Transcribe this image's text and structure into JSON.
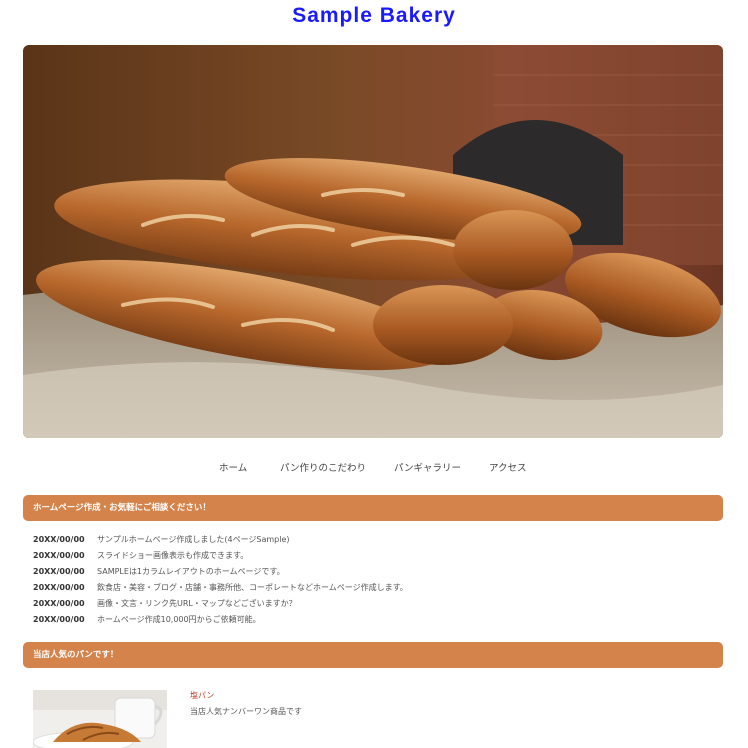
{
  "site": {
    "title": "Sample Bakery",
    "accent_color": "#d4834a",
    "title_color": "#1a1aff"
  },
  "hero": {
    "image": "baguettes-photo"
  },
  "nav": {
    "items": [
      {
        "label": "ホーム"
      },
      {
        "label": "パン作りのこだわり"
      },
      {
        "label": "パンギャラリー"
      },
      {
        "label": "アクセス"
      }
    ]
  },
  "news": {
    "heading": "ホームページ作成・お気軽にご相談ください！",
    "items": [
      {
        "date": "20XX/00/00",
        "text": "サンプルホームページ作成しました(4ページSample)"
      },
      {
        "date": "20XX/00/00",
        "text": "スライドショー画像表示も作成できます。"
      },
      {
        "date": "20XX/00/00",
        "text": "SAMPLEは1カラムレイアウトのホームページです。"
      },
      {
        "date": "20XX/00/00",
        "text": "飲食店・美容・ブログ・店舗・事務所他、コーポレートなどホームページ作成します。"
      },
      {
        "date": "20XX/00/00",
        "text": "画像・文言・リンク先URL・マップなどございますか？"
      },
      {
        "date": "20XX/00/00",
        "text": "ホームページ作成10,000円からご依頼可能。"
      }
    ]
  },
  "popular": {
    "heading": "当店人気のパンです！",
    "products": [
      {
        "name": "塩パン",
        "description": "当店人気ナンバーワン商品です",
        "image": "croissant-photo"
      }
    ]
  }
}
